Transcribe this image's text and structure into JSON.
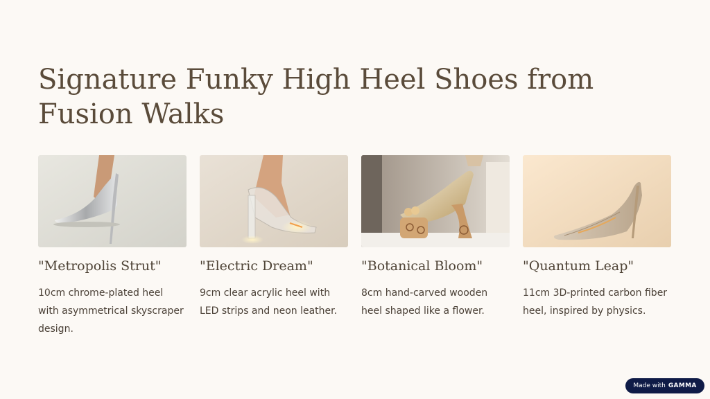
{
  "slide": {
    "title": "Signature Funky High Heel Shoes from Fusion Walks"
  },
  "cards": [
    {
      "title": "\"Metropolis Strut\"",
      "description": "10cm chrome-plated heel with asymmetrical skyscraper design."
    },
    {
      "title": "\"Electric Dream\"",
      "description": "9cm clear acrylic heel with LED strips and neon leather."
    },
    {
      "title": "\"Botanical Bloom\"",
      "description": "8cm hand-carved wooden heel shaped like a flower."
    },
    {
      "title": "\"Quantum Leap\"",
      "description": "11cm 3D-printed carbon fiber heel, inspired by physics."
    }
  ],
  "badge": {
    "prefix": "Made with",
    "brand": "GAMMA"
  },
  "colors": {
    "background": "#fcf9f5",
    "title": "#5a4b3a",
    "badge": "#0f1b47"
  }
}
